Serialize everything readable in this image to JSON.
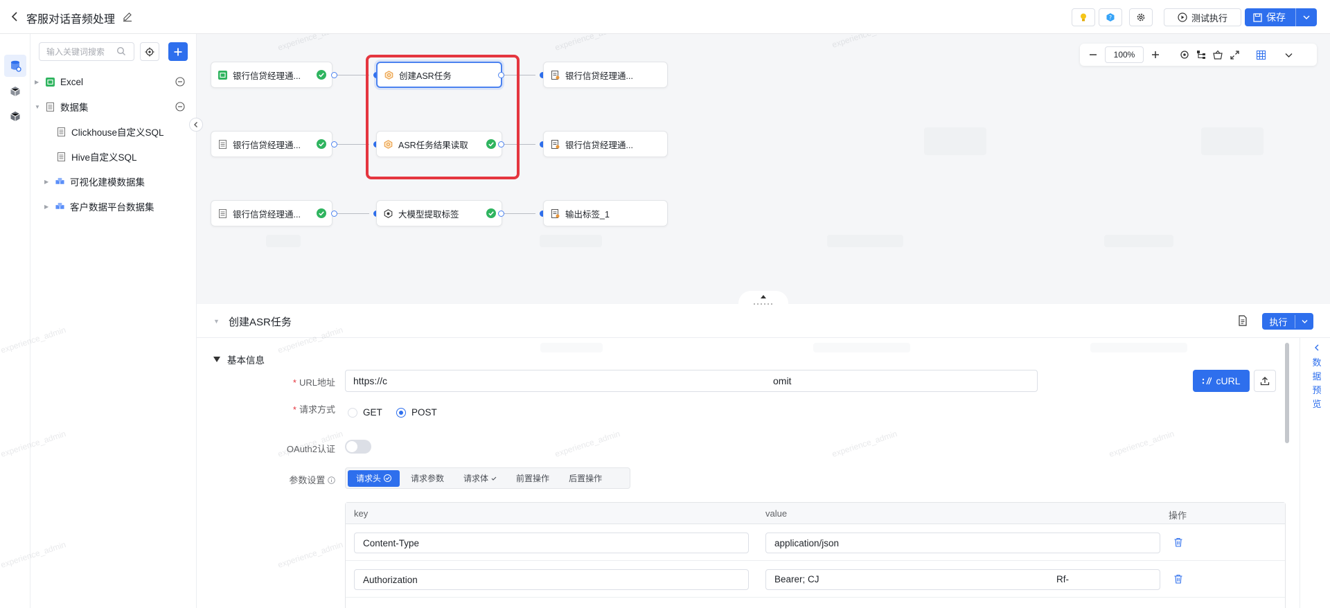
{
  "header": {
    "title": "客服对话音频处理",
    "test_run_label": "测试执行",
    "save_label": "保存"
  },
  "sidebar": {
    "search_placeholder": "输入关键词搜索",
    "tree": [
      {
        "label": "Excel",
        "icon": "excel-icon"
      },
      {
        "label": "数据集",
        "icon": "dataset-icon"
      },
      {
        "label": "Clickhouse自定义SQL",
        "icon": "sql-file-icon"
      },
      {
        "label": "Hive自定义SQL",
        "icon": "sql-file-icon"
      },
      {
        "label": "可视化建模数据集",
        "icon": "cube-group-icon"
      },
      {
        "label": "客户数据平台数据集",
        "icon": "cube-group-icon"
      }
    ]
  },
  "canvas": {
    "zoom": "100%",
    "watermark": "experience_admin",
    "nodes": [
      {
        "label": "银行信贷经理通...",
        "status": "success"
      },
      {
        "label": "创建ASR任务",
        "status": "selected"
      },
      {
        "label": "银行信贷经理通...",
        "status": "none"
      },
      {
        "label": "银行信贷经理通...",
        "status": "success"
      },
      {
        "label": "ASR任务结果读取",
        "status": "success"
      },
      {
        "label": "银行信贷经理通...",
        "status": "none"
      },
      {
        "label": "银行信贷经理通...",
        "status": "success"
      },
      {
        "label": "大模型提取标签",
        "status": "success"
      },
      {
        "label": "输出标签_1",
        "status": "none"
      }
    ]
  },
  "panel": {
    "title": "创建ASR任务",
    "exec_label": "执行",
    "section": "基本信息",
    "url_label": "URL地址",
    "url_value_start": "https://c",
    "url_value_end": "omit",
    "curl_label": "cURL",
    "method_label": "请求方式",
    "methods": [
      {
        "label": "GET",
        "selected": false
      },
      {
        "label": "POST",
        "selected": true
      }
    ],
    "oauth_label": "OAuth2认证",
    "oauth_enabled": false,
    "params_label": "参数设置",
    "tabs": [
      "请求头",
      "请求参数",
      "请求体",
      "前置操作",
      "后置操作"
    ],
    "table": {
      "columns": [
        "key",
        "value",
        "操作"
      ],
      "rows": [
        {
          "key": "Content-Type",
          "value_start": "application/json",
          "value_end": ""
        },
        {
          "key": "Authorization",
          "value_start": "Bearer; CJ",
          "value_end": "Rf-"
        }
      ]
    },
    "preview_label": [
      "数",
      "据",
      "预",
      "览"
    ]
  },
  "colors": {
    "primary": "#2e6fed",
    "highlight": "#e5363f",
    "success": "#2fb45f"
  }
}
